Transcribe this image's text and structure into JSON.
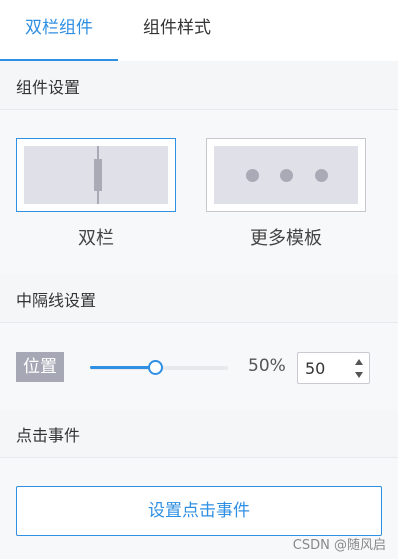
{
  "tabs": [
    {
      "label": "双栏组件",
      "active": true
    },
    {
      "label": "组件样式",
      "active": false
    }
  ],
  "component_settings": {
    "title": "组件设置",
    "templates": [
      {
        "label": "双栏",
        "selected": true
      },
      {
        "label": "更多模板",
        "selected": false
      }
    ]
  },
  "divider_settings": {
    "title": "中隔线设置",
    "position_label": "位置",
    "percent_text": "50%",
    "value": "50",
    "slider_fraction": 0.5
  },
  "click_event": {
    "title": "点击事件",
    "button_label": "设置点击事件"
  },
  "watermark": "CSDN @随风启",
  "colors": {
    "accent": "#2f8fe3",
    "label_bg": "#a6a9b5"
  }
}
